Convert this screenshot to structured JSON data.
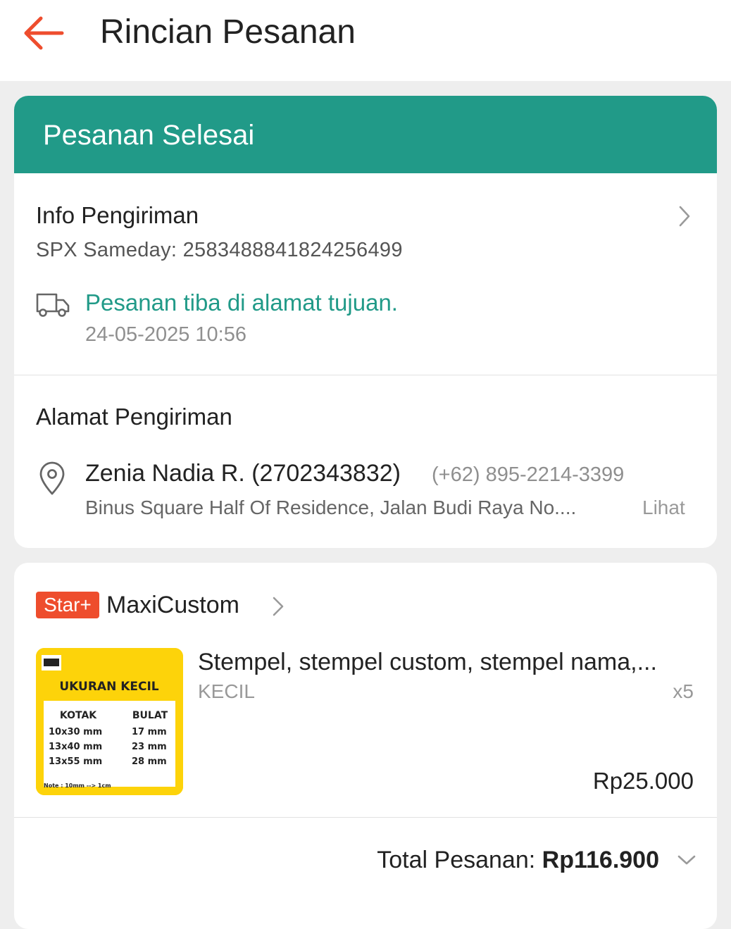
{
  "header": {
    "title": "Rincian Pesanan",
    "back_icon": "arrow-left-icon",
    "accent_color": "#ee4d2d"
  },
  "status": {
    "label": "Pesanan Selesai",
    "color": "#219a88"
  },
  "shipping_info": {
    "heading": "Info Pengiriman",
    "tracking": "SPX Sameday: 2583488841824256499",
    "latest_status": "Pesanan tiba di alamat tujuan.",
    "latest_time": "24-05-2025 10:56",
    "icon": "truck-icon"
  },
  "address": {
    "heading": "Alamat Pengiriman",
    "name": "Zenia Nadia R. (2702343832)",
    "phone": "(+62) 895-2214-3399",
    "detail": "Binus Square Half Of Residence, Jalan Budi Raya No....",
    "see_more": "Lihat",
    "icon": "location-pin-icon"
  },
  "shop": {
    "badge": "Star+",
    "name": "MaxiCustom"
  },
  "product": {
    "name": "Stempel, stempel custom, stempel nama,...",
    "variant": "KECIL",
    "quantity": "x5",
    "price": "Rp25.000",
    "thumbnail": {
      "title": "UKURAN KECIL",
      "col1_header": "KOTAK",
      "col2_header": "BULAT",
      "rows": [
        [
          "10x30 mm",
          "17 mm"
        ],
        [
          "13x40 mm",
          "23 mm"
        ],
        [
          "13x55 mm",
          "28 mm"
        ]
      ],
      "note": "Note : 10mm --> 1cm"
    }
  },
  "order_total": {
    "label": "Total Pesanan: ",
    "value": "Rp116.900"
  }
}
